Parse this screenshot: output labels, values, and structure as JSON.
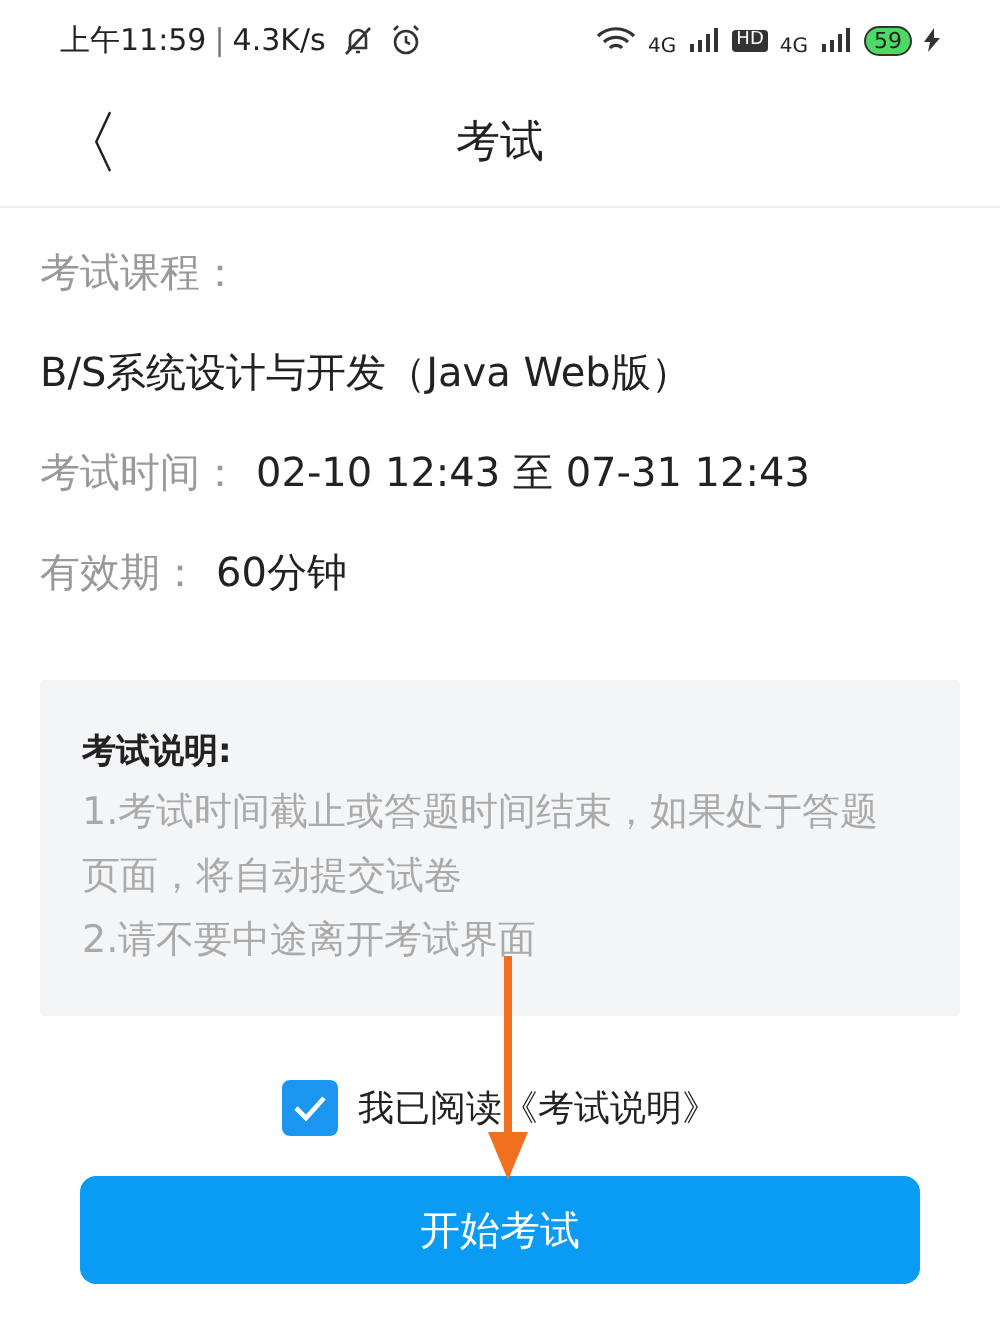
{
  "status_bar": {
    "time": "上午11:59",
    "separator": "|",
    "speed": "4.3K/s",
    "network_1": "4G",
    "hd": "HD",
    "network_2": "4G",
    "battery": "59"
  },
  "header": {
    "back": "〈",
    "title": "考试"
  },
  "info": [
    {
      "kind": "label",
      "text": "考试课程："
    },
    {
      "kind": "value",
      "text": "B/S系统设计与开发（Java Web版）"
    },
    {
      "kind": "pair",
      "label": "考试时间：",
      "value": "02-10 12:43 至 07-31 12:43"
    },
    {
      "kind": "pair",
      "label": "有效期：",
      "value": "60分钟"
    }
  ],
  "notice": {
    "title": "考试说明:",
    "lines": [
      "1.考试时间截止或答题时间结束，如果处于答题页面，将自动提交试卷",
      "2.请不要中途离开考试界面"
    ]
  },
  "agreement": {
    "checked": true,
    "label": "我已阅读《考试说明》"
  },
  "start_button": "开始考试"
}
